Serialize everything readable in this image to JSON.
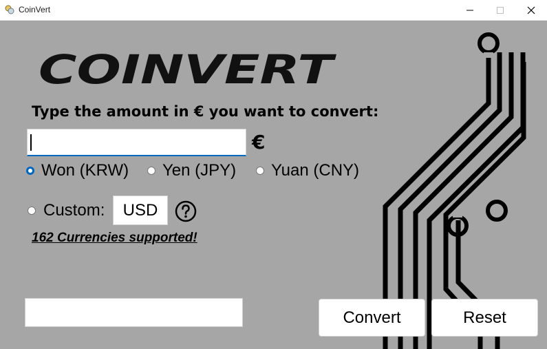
{
  "window": {
    "title": "CoinVert",
    "app_icon": "coins-icon",
    "minimize_icon": "minimize-icon",
    "maximize_icon": "maximize-icon",
    "close_icon": "close-icon"
  },
  "logo": {
    "text": "COINVERT"
  },
  "form": {
    "prompt": "Type the amount in € you want to convert:",
    "amount_value": "",
    "currency_symbol": "€",
    "options": [
      {
        "label": "Won (KRW)",
        "checked": true
      },
      {
        "label": "Yen (JPY)",
        "checked": false
      },
      {
        "label": "Yuan (CNY)",
        "checked": false
      }
    ],
    "custom_label": "Custom:",
    "custom_value": "USD",
    "help_icon": "question-circle-icon",
    "supported_text": "162 Currencies supported!",
    "result_value": ""
  },
  "buttons": {
    "convert": "Convert",
    "reset": "Reset"
  },
  "colors": {
    "background": "#a6a6a6",
    "accent": "#0067c0",
    "circuit": "#000000"
  }
}
